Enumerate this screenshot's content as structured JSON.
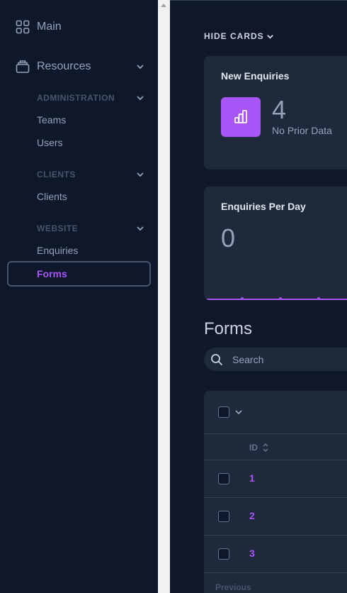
{
  "sidebar": {
    "main_label": "Main",
    "resources_label": "Resources",
    "sections": [
      {
        "title": "ADMINISTRATION",
        "items": [
          "Teams",
          "Users"
        ]
      },
      {
        "title": "CLIENTS",
        "items": [
          "Clients"
        ]
      },
      {
        "title": "WEBSITE",
        "items": [
          "Enquiries",
          "Forms"
        ]
      }
    ],
    "active_item": "Forms"
  },
  "main": {
    "hide_cards_label": "HIDE CARDS",
    "cards": {
      "new_enquiries": {
        "title": "New Enquiries",
        "value": "4",
        "subtitle": "No Prior Data"
      },
      "enquiries_per_day": {
        "title": "Enquiries Per Day",
        "value": "0"
      }
    },
    "forms_title": "Forms",
    "search": {
      "placeholder": "Search"
    },
    "table": {
      "columns": [
        "ID"
      ],
      "rows": [
        {
          "id": "1"
        },
        {
          "id": "2"
        },
        {
          "id": "3"
        }
      ],
      "pagination_previous": "Previous"
    }
  },
  "colors": {
    "accent": "#a855f7",
    "background": "#0f172a",
    "card": "#1e293b"
  },
  "icons": [
    "grid-icon",
    "box-icon",
    "chevron-down-icon",
    "chart-bar-icon",
    "search-icon",
    "sort-icon"
  ]
}
